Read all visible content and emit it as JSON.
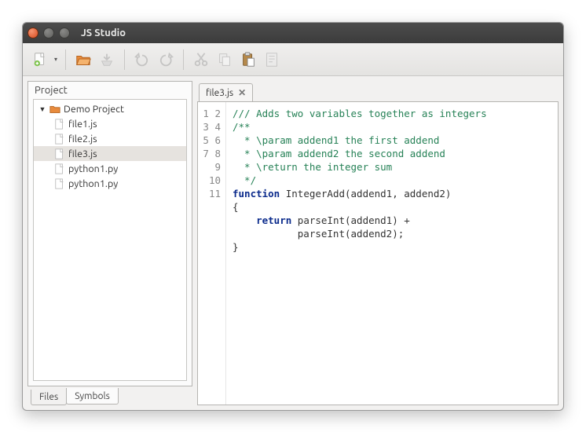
{
  "window": {
    "title": "JS Studio"
  },
  "toolbar": {
    "new": "new-file",
    "open": "open-file",
    "save": "save-file",
    "undo": "undo",
    "redo": "redo",
    "cut": "cut",
    "copy": "copy",
    "paste": "paste",
    "mark": "bookmark"
  },
  "project_panel": {
    "title": "Project",
    "root": "Demo Project",
    "files": [
      {
        "name": "file1.js",
        "selected": false
      },
      {
        "name": "file2.js",
        "selected": false
      },
      {
        "name": "file3.js",
        "selected": true
      },
      {
        "name": "python1.py",
        "selected": false
      },
      {
        "name": "python1.py",
        "selected": false
      }
    ],
    "tabs": {
      "files": "Files",
      "symbols": "Symbols",
      "active": "Symbols"
    }
  },
  "editor": {
    "tab_label": "file3.js",
    "line_count": 11,
    "code": {
      "l1": "/// Adds two variables together as integers",
      "l2": "/**",
      "l3": "  * \\param addend1 the first addend",
      "l4": "  * \\param addend2 the second addend",
      "l5": "  * \\return the integer sum",
      "l6": "  */",
      "l7a": "function",
      "l7b": " IntegerAdd(addend1, addend2)",
      "l8": "{",
      "l9a": "    ",
      "l9b": "return",
      "l9c": " parseInt(addend1) +",
      "l10a": "           parseInt(addend2);",
      "l11": "}"
    }
  }
}
